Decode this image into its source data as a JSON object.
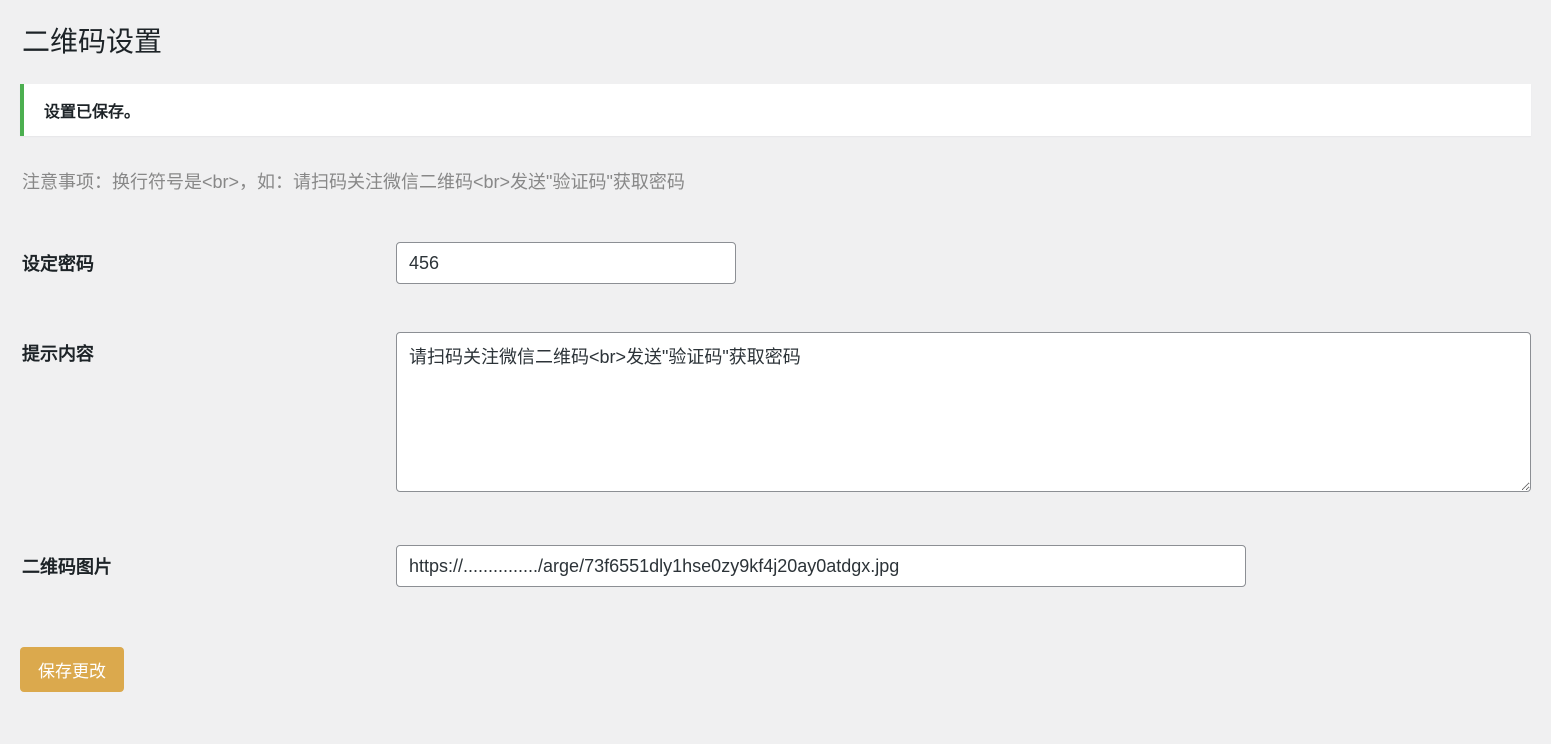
{
  "page": {
    "title": "二维码设置"
  },
  "notice": {
    "text": "设置已保存。"
  },
  "help": {
    "text": "注意事项：换行符号是<br>，如：请扫码关注微信二维码<br>发送\"验证码\"获取密码"
  },
  "form": {
    "password": {
      "label": "设定密码",
      "value": "456"
    },
    "prompt": {
      "label": "提示内容",
      "value": "请扫码关注微信二维码<br>发送\"验证码\"获取密码"
    },
    "qrimage": {
      "label": "二维码图片",
      "value": "https://.............../arge/73f6551dly1hse0zy9kf4j20ay0atdgx.jpg"
    },
    "submit": {
      "label": "保存更改"
    }
  }
}
